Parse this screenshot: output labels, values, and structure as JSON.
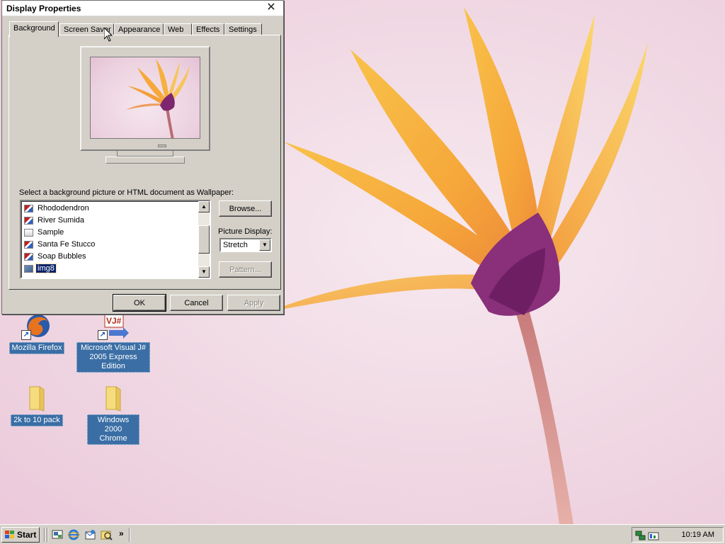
{
  "dialog": {
    "title": "Display Properties",
    "tabs": [
      "Background",
      "Screen Saver",
      "Appearance",
      "Web",
      "Effects",
      "Settings"
    ],
    "active_tab": "Background",
    "prompt": "Select a background picture or HTML document as Wallpaper:",
    "wallpapers": [
      {
        "name": "Rhododendron",
        "icon": "image-file-icon"
      },
      {
        "name": "River Sumida",
        "icon": "image-file-icon"
      },
      {
        "name": "Sample",
        "icon": "html-file-icon"
      },
      {
        "name": "Santa Fe Stucco",
        "icon": "image-file-icon"
      },
      {
        "name": "Soap Bubbles",
        "icon": "image-file-icon"
      },
      {
        "name": "img8",
        "icon": "picture-file-icon",
        "selected": true
      }
    ],
    "browse_label": "Browse...",
    "picture_display_label": "Picture Display:",
    "picture_display_value": "Stretch",
    "pattern_label": "Pattern...",
    "ok_label": "OK",
    "cancel_label": "Cancel",
    "apply_label": "Apply"
  },
  "desktop_icons": [
    {
      "label": "Mozilla Firefox",
      "icon": "firefox-icon"
    },
    {
      "label": "Microsoft Visual J# 2005 Express Edition",
      "icon": "visual-jsharp-icon"
    },
    {
      "label": "2k to 10 pack",
      "icon": "folder-icon"
    },
    {
      "label": "Windows 2000 Chrome",
      "icon": "folder-icon"
    }
  ],
  "taskbar": {
    "start_label": "Start",
    "quick_launch": [
      "show-desktop-icon",
      "internet-explorer-icon",
      "outlook-express-icon",
      "windows-explorer-icon"
    ],
    "overflow": "»",
    "tray_icons": [
      "network-icon",
      "volume-icon"
    ],
    "clock": "10:19 AM"
  },
  "colors": {
    "selection": "#0a246a",
    "desktop_label_bg": "#3a6ea5",
    "face": "#d4d0c8"
  }
}
